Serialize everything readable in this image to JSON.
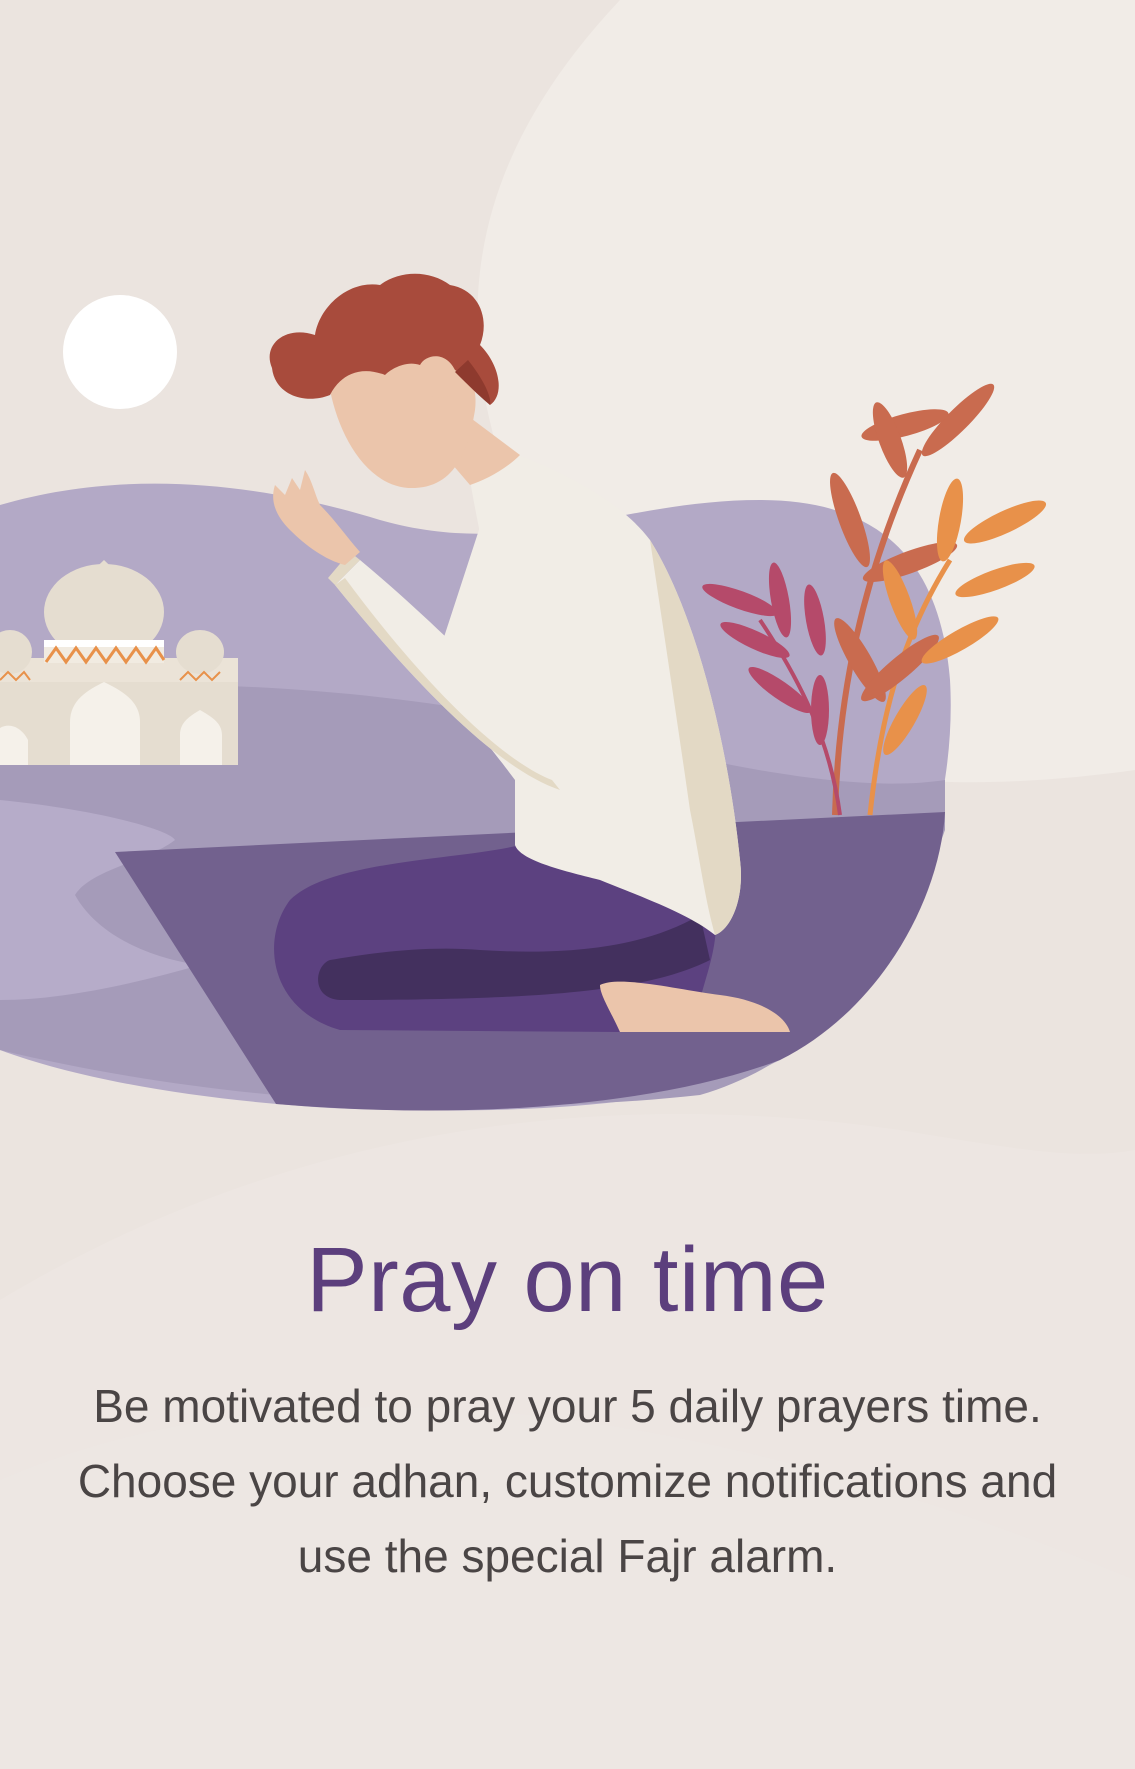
{
  "onboarding": {
    "title": "Pray on time",
    "description_lines": [
      "Be motivated to pray your 5 daily prayers time.",
      "Choose your adhan, customize notifications and",
      "use the special Fajr alarm."
    ]
  },
  "colors": {
    "background": "#ece6e2",
    "title": "#5c3f7d",
    "body_text": "#4a4545",
    "hill": "#b3a9c6",
    "prayer_mat": "#72618e",
    "pants": "#5c4180",
    "hair": "#a84b3c",
    "plant_red": "#c96b4f",
    "plant_orange": "#e8914a",
    "plant_pink": "#b54a6a"
  },
  "illustration": {
    "icon": "man-praying-illustration-icon",
    "elements": [
      "moon-icon",
      "mosque-icon",
      "plant-icon",
      "prayer-mat-icon"
    ]
  }
}
